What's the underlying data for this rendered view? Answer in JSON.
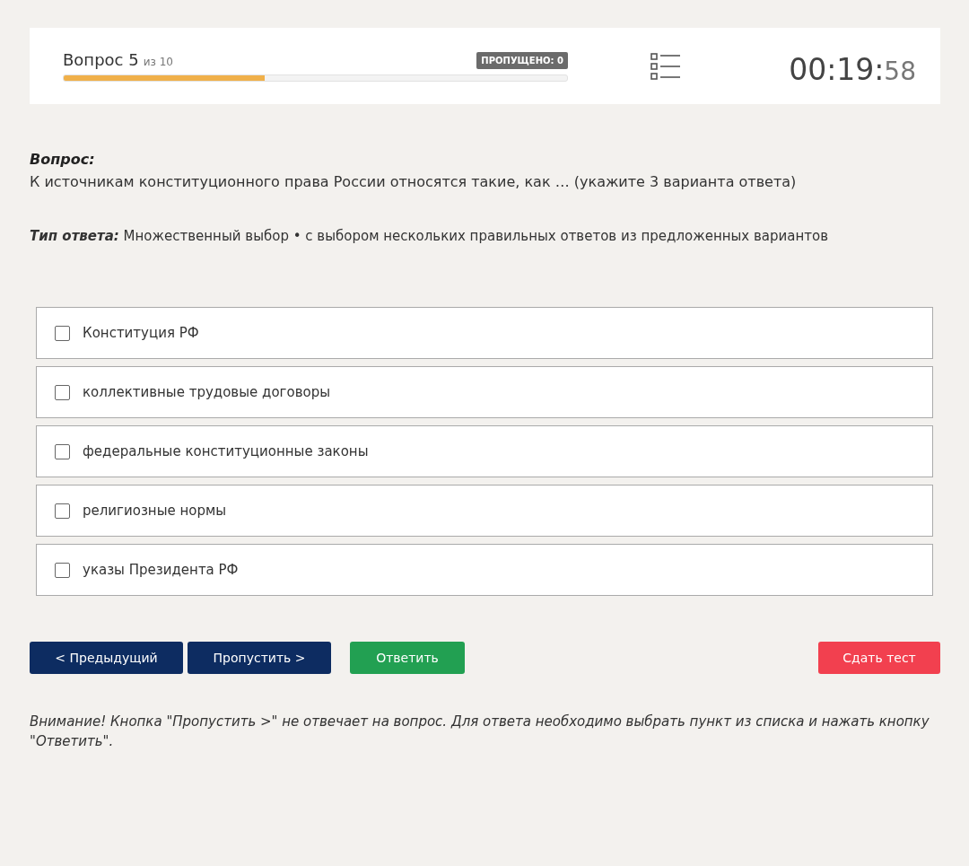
{
  "header": {
    "question_label": "Вопрос 5",
    "question_total": "из 10",
    "skipped_badge": "ПРОПУЩЕНО: 0",
    "progress": {
      "level": 0.4
    },
    "timer_main": "00:19:",
    "timer_seconds": "58"
  },
  "question": {
    "label": "Вопрос:",
    "text": "К источникам конституционного права России относятся такие, как … (укажите 3 варианта ответа)"
  },
  "answer_type": {
    "label": "Тип ответа:",
    "text": "Множественный выбор • с выбором нескольких правильных ответов из предложенных вариантов"
  },
  "options": [
    {
      "label": "Конституция РФ",
      "checked": false
    },
    {
      "label": "коллективные трудовые договоры",
      "checked": false
    },
    {
      "label": "федеральные конституционные законы",
      "checked": false
    },
    {
      "label": "религиозные нормы",
      "checked": false
    },
    {
      "label": "указы Президента РФ",
      "checked": false
    }
  ],
  "buttons": [
    {
      "label": "< Предыдущий",
      "kind": "prev"
    },
    {
      "label": "Пропустить >",
      "kind": "skip"
    },
    {
      "label": "Ответить",
      "kind": "answer"
    },
    {
      "label": "Сдать тест",
      "kind": "finish"
    }
  ],
  "notice": "Внимание! Кнопка \"Пропустить >\" не отвечает на вопрос. Для ответа необходимо выбрать пункт из списка и нажать кнопку \"Ответить\"."
}
